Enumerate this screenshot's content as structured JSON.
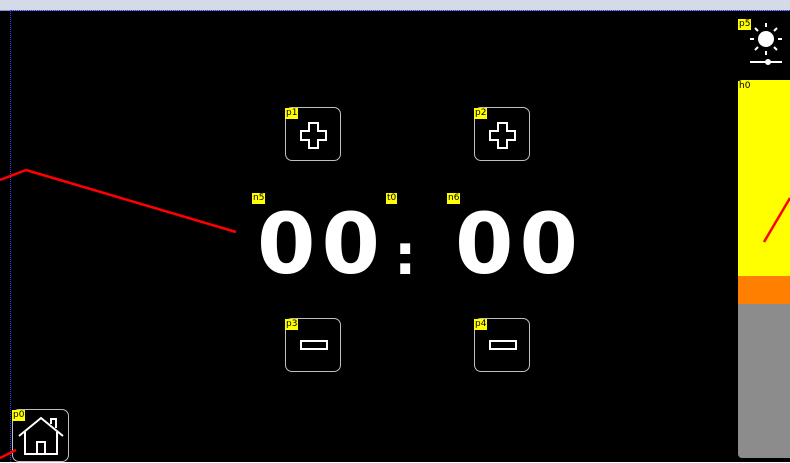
{
  "tags": {
    "p0": "p0",
    "p1": "p1",
    "p2": "p2",
    "p3": "p3",
    "p4": "p4",
    "p5": "p5",
    "n5": "n5",
    "n6": "n6",
    "t0": "t0",
    "h0": "h0"
  },
  "timer": {
    "minutes": "00",
    "separator": ":",
    "seconds": "00"
  },
  "icons": {
    "increase_minutes": "plus-icon",
    "increase_seconds": "plus-icon",
    "decrease_minutes": "minus-icon",
    "decrease_seconds": "minus-icon",
    "home": "home-icon",
    "brightness": "sun-icon"
  },
  "colors": {
    "background": "#000000",
    "bar_fill": "#ffff00",
    "bar_marker": "#ff8000",
    "bar_track": "#8c8c8c",
    "annotation_line": "#ff0000",
    "tag_bg": "#ffff00"
  }
}
